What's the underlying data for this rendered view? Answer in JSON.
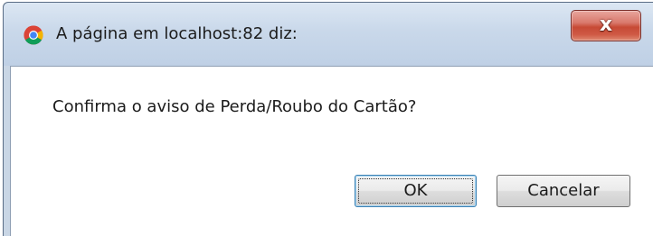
{
  "dialog": {
    "title": "A página em localhost:82 diz:",
    "app_icon": "chrome-icon",
    "close_icon": "close-icon",
    "close_symbol": "x",
    "message": "Confirma o aviso de Perda/Roubo do Cartão?",
    "buttons": {
      "ok_label": "OK",
      "cancel_label": "Cancelar"
    }
  },
  "colors": {
    "titlebar": "#c9d8ea",
    "close_button": "#c74a35",
    "content_background": "#ffffff"
  }
}
